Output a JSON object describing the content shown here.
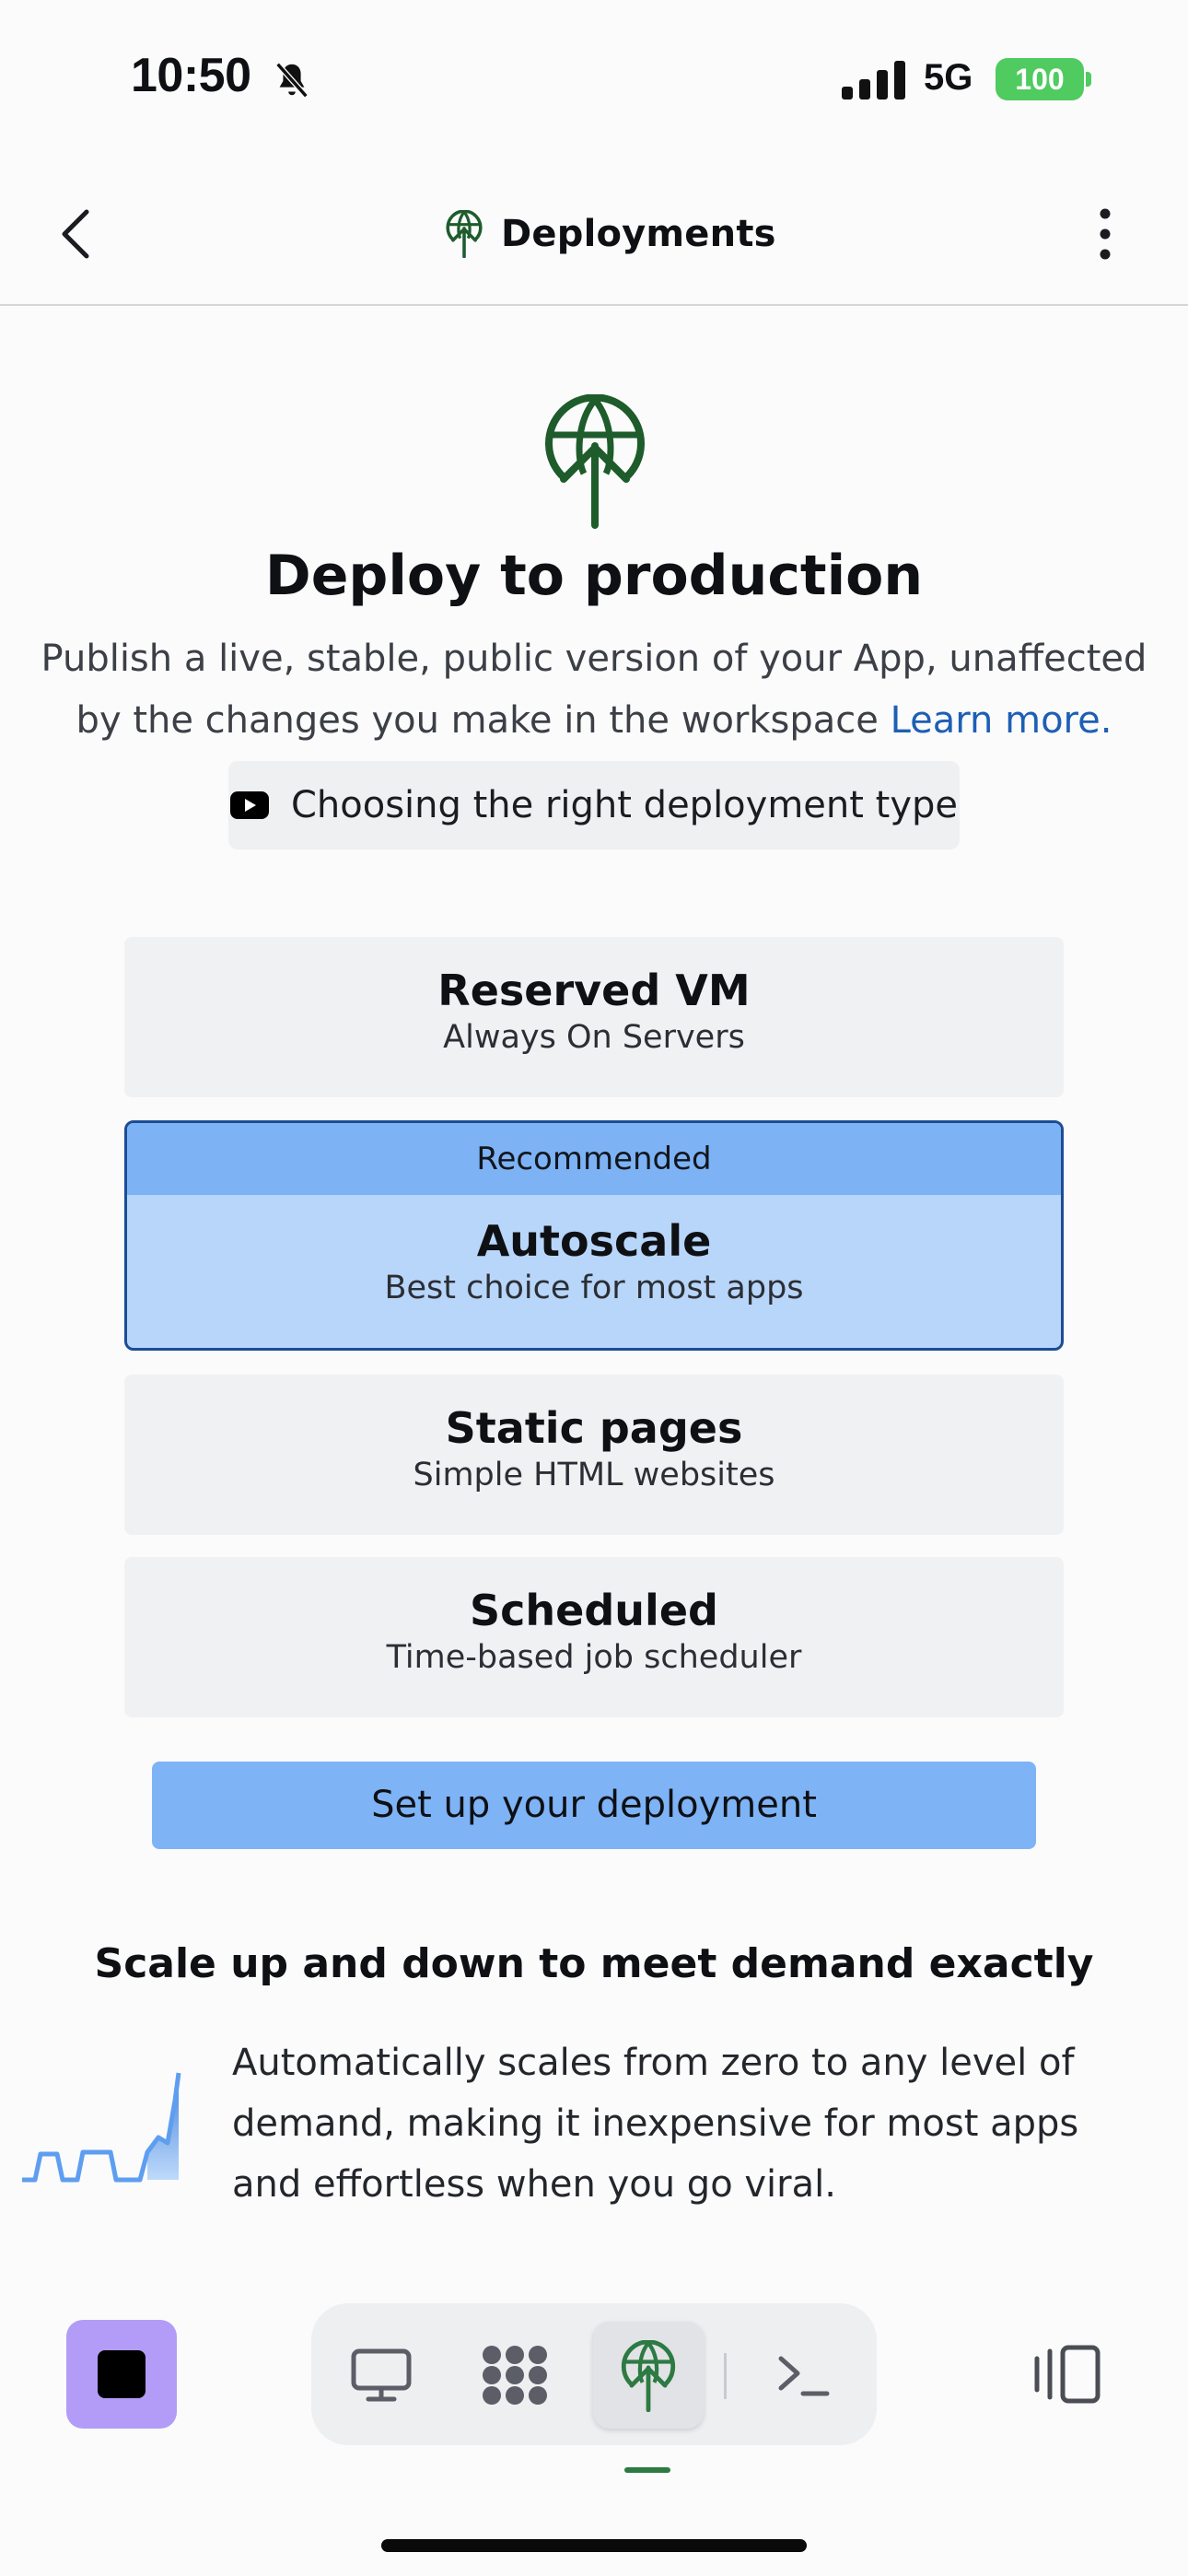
{
  "status_bar": {
    "time": "10:50",
    "network": "5G",
    "battery": "100"
  },
  "header": {
    "title": "Deployments",
    "back_icon": "chevron-left-icon",
    "menu_icon": "more-vertical-icon"
  },
  "hero": {
    "title": "Deploy to production",
    "description": "Publish a live, stable, public version of your App, unaffected by the changes you make in the workspace",
    "learn_more": "Learn more.",
    "video_chip_label": "Choosing the right deployment type"
  },
  "options": [
    {
      "title": "Reserved VM",
      "subtitle": "Always On Servers"
    },
    {
      "badge": "Recommended",
      "title": "Autoscale",
      "subtitle": "Best choice for most apps",
      "selected": true
    },
    {
      "title": "Static pages",
      "subtitle": "Simple HTML websites"
    },
    {
      "title": "Scheduled",
      "subtitle": "Time-based job scheduler"
    }
  ],
  "cta_label": "Set up your deployment",
  "feature": {
    "title": "Scale up and down to meet demand exactly",
    "description": "Automatically scales from zero to any level of demand, making it inexpensive for most apps and effortless when you go viral."
  },
  "toolbar": {
    "stop_icon": "stop-icon",
    "tabs": [
      "webview-icon",
      "workspace-icon",
      "deployments-icon",
      "console-icon"
    ],
    "active_tab": "deployments-icon",
    "layout_icon": "layout-toggle-icon"
  },
  "colors": {
    "accent_blue": "#7db2f5",
    "selected_bg": "#b8d6fa",
    "brand_green": "#1e5c2b",
    "stop_purple": "#b39cf7",
    "link": "#1d5fb4"
  }
}
